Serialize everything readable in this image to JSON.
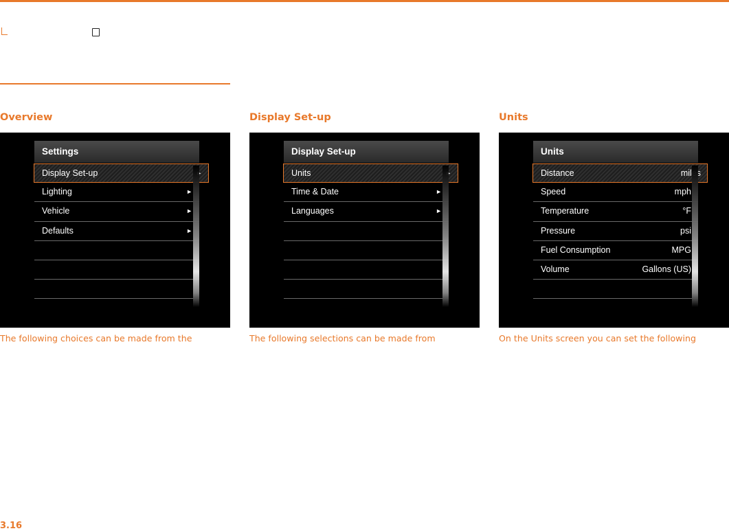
{
  "page_number": "3.16",
  "columns": [
    {
      "heading": "Overview",
      "screen_title": "Settings",
      "rows": [
        {
          "label": "Display Set-up",
          "value": "►",
          "selected": true
        },
        {
          "label": "Lighting",
          "value": "►"
        },
        {
          "label": "Vehicle",
          "value": "►"
        },
        {
          "label": "Defaults",
          "value": "►"
        },
        {
          "label": "",
          "value": ""
        },
        {
          "label": "",
          "value": ""
        },
        {
          "label": "",
          "value": ""
        }
      ],
      "caption": "The following choices can be made from the"
    },
    {
      "heading": "Display Set-up",
      "screen_title": "Display Set-up",
      "rows": [
        {
          "label": "Units",
          "value": "►",
          "selected": true
        },
        {
          "label": "Time & Date",
          "value": "►"
        },
        {
          "label": "Languages",
          "value": "►"
        },
        {
          "label": "",
          "value": ""
        },
        {
          "label": "",
          "value": ""
        },
        {
          "label": "",
          "value": ""
        },
        {
          "label": "",
          "value": ""
        }
      ],
      "caption": "The following selections can be made from"
    },
    {
      "heading": "Units",
      "screen_title": "Units",
      "rows": [
        {
          "label": "Distance",
          "value": "miles",
          "selected": true
        },
        {
          "label": "Speed",
          "value": "mph"
        },
        {
          "label": "Temperature",
          "value": "°F"
        },
        {
          "label": "Pressure",
          "value": "psi"
        },
        {
          "label": "Fuel Consumption",
          "value": "MPG"
        },
        {
          "label": "Volume",
          "value": "Gallons (US)"
        },
        {
          "label": "",
          "value": ""
        }
      ],
      "caption": "On the Units screen you can set the following"
    }
  ]
}
